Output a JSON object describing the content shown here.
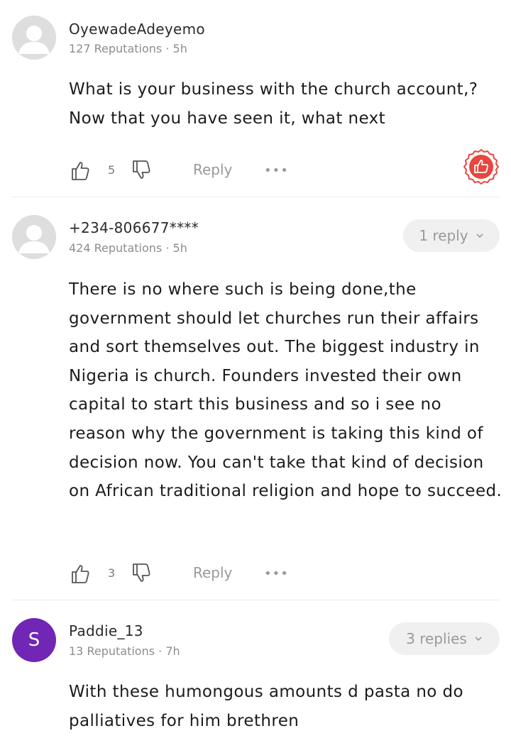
{
  "comments": [
    {
      "username": "OyewadeAdeyemo",
      "reputation": "127 Reputations",
      "time": "5h",
      "text": "What is your business with the church account,? Now that you have seen it, what next",
      "likes": "5",
      "reply_label": "Reply",
      "more_label": "•••",
      "avatar_icon": "default-user-avatar-icon",
      "badge_icon": "thumbs-up-badge-icon",
      "badge_color": "#e8473f"
    },
    {
      "username": "+234-806677****",
      "reputation": "424 Reputations",
      "time": "5h",
      "text": "There is no where such is being done,the government should let churches run their affairs and sort themselves out. The biggest industry in Nigeria is church. Founders invested their own capital to start this business and so i see no reason why the government is taking this kind of decision now.  You can't take that kind of decision on African traditional religion and hope to succeed.",
      "likes": "3",
      "reply_label": "Reply",
      "more_label": "•••",
      "replies_label": "1 reply",
      "avatar_icon": "default-user-avatar-icon"
    },
    {
      "username": "Paddie_13",
      "reputation": "13 Reputations",
      "time": "7h",
      "text": "With these humongous amounts d pasta no do palliatives for him brethren",
      "replies_label": "3 replies",
      "avatar_letter": "S",
      "avatar_color": "#7126b5"
    }
  ],
  "meta_separator": "·"
}
